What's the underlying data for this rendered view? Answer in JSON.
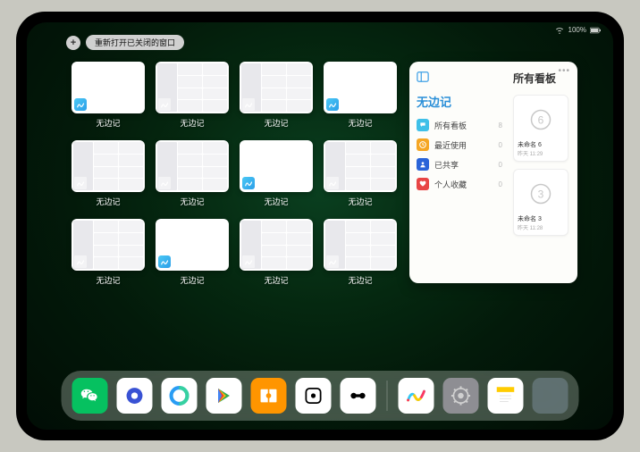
{
  "statusbar": {
    "battery_pct": "100%"
  },
  "topbar": {
    "plus": "+",
    "reopen_label": "重新打开已关闭的窗口"
  },
  "windows": [
    {
      "type": "blank",
      "label": "无边记"
    },
    {
      "type": "cal",
      "label": "无边记"
    },
    {
      "type": "cal",
      "label": "无边记"
    },
    {
      "type": "blank",
      "label": "无边记"
    },
    {
      "type": "cal",
      "label": "无边记"
    },
    {
      "type": "cal",
      "label": "无边记"
    },
    {
      "type": "blank",
      "label": "无边记"
    },
    {
      "type": "cal",
      "label": "无边记"
    },
    {
      "type": "cal",
      "label": "无边记"
    },
    {
      "type": "blank",
      "label": "无边记"
    },
    {
      "type": "cal",
      "label": "无边记"
    },
    {
      "type": "cal",
      "label": "无边记"
    }
  ],
  "panel": {
    "app_title": "无边记",
    "sections": [
      {
        "icon": "chat",
        "color": "#3fc0e8",
        "name": "所有看板",
        "count": "8"
      },
      {
        "icon": "clock",
        "color": "#f5a623",
        "name": "最近使用",
        "count": "0"
      },
      {
        "icon": "people",
        "color": "#2a64d8",
        "name": "已共享",
        "count": "0"
      },
      {
        "icon": "heart",
        "color": "#e84545",
        "name": "个人收藏",
        "count": "0"
      }
    ],
    "right_title": "所有看板",
    "boards": [
      {
        "digit": "6",
        "name": "未命名 6",
        "time": "昨天 11:29"
      },
      {
        "digit": "3",
        "name": "未命名 3",
        "time": "昨天 11:28"
      }
    ]
  },
  "dock": {
    "apps": [
      {
        "name": "wechat",
        "bg": "#06c160"
      },
      {
        "name": "quark",
        "bg": "#fff"
      },
      {
        "name": "qqbrowser",
        "bg": "#fff"
      },
      {
        "name": "play",
        "bg": "#fff"
      },
      {
        "name": "books",
        "bg": "#ff9500"
      },
      {
        "name": "dice",
        "bg": "#fff"
      },
      {
        "name": "connect",
        "bg": "#fff"
      }
    ],
    "recent": [
      {
        "name": "freeform",
        "bg": "#fff"
      },
      {
        "name": "settings",
        "bg": "#8e8e93"
      },
      {
        "name": "notes",
        "bg": "#fff"
      },
      {
        "name": "folder",
        "bg": "folder"
      }
    ]
  }
}
